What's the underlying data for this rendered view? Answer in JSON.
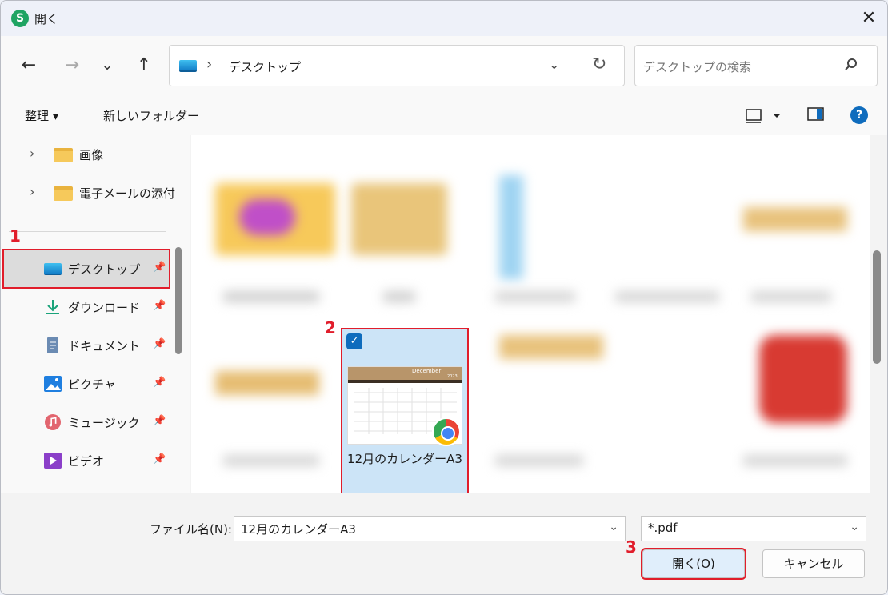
{
  "window": {
    "title": "開く",
    "app_icon_letter": "S"
  },
  "nav": {
    "back": "←",
    "forward": "→",
    "recent": "⌄",
    "up": "↑"
  },
  "address": {
    "separator": "›",
    "path": "デスクトップ"
  },
  "search": {
    "placeholder": "デスクトップの検索"
  },
  "commands": {
    "organize": "整理 ▾",
    "new_folder": "新しいフォルダー"
  },
  "sidebar": {
    "tree": [
      {
        "label": "画像"
      },
      {
        "label": "電子メールの添付"
      }
    ],
    "quick_access": [
      {
        "label": "デスクトップ",
        "icon": "desktop-icon"
      },
      {
        "label": "ダウンロード",
        "icon": "download-icon"
      },
      {
        "label": "ドキュメント",
        "icon": "documents-icon"
      },
      {
        "label": "ピクチャ",
        "icon": "pictures-icon"
      },
      {
        "label": "ミュージック",
        "icon": "music-icon"
      },
      {
        "label": "ビデオ",
        "icon": "videos-icon"
      }
    ]
  },
  "selected_file": {
    "name": "12月のカレンダーA3",
    "thumb_title": "December",
    "thumb_year": "2023",
    "checked": true
  },
  "footer": {
    "filename_label": "ファイル名(N):",
    "filename_value": "12月のカレンダーA3",
    "filetype": "*.pdf",
    "open_button": "開く(O)",
    "cancel_button": "キャンセル"
  },
  "annotations": {
    "step1": "1",
    "step2": "2",
    "step3": "3"
  },
  "colors": {
    "accent": "#0f6cbd",
    "highlight": "#e11d2b",
    "selection": "#cce4f7"
  }
}
